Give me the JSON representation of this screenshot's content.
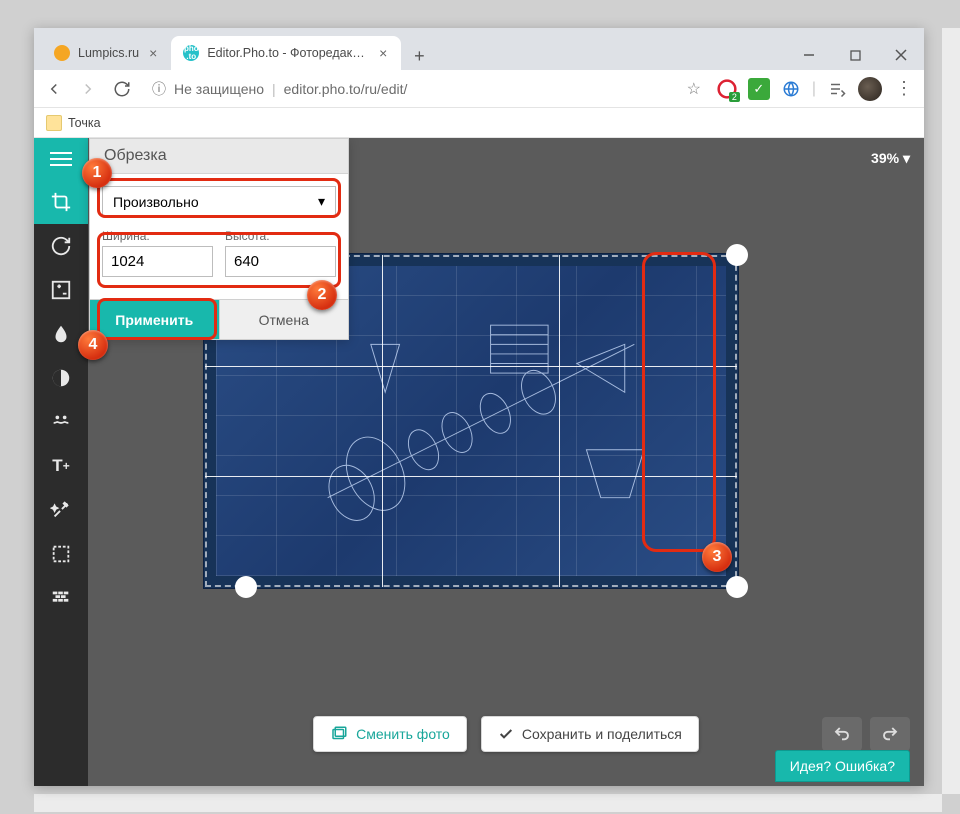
{
  "colors": {
    "accent": "#18b8ac",
    "marker": "#e22b12"
  },
  "browser": {
    "tabs": [
      {
        "title": "Lumpics.ru",
        "active": false
      },
      {
        "title": "Editor.Pho.to - Фоторедактор он",
        "active": true
      }
    ],
    "insecure_label": "Не защищено",
    "url": "editor.pho.to/ru/edit/",
    "adblock_badge": "2",
    "bookmarks": [
      {
        "label": "Точка"
      }
    ]
  },
  "sidebar": {
    "tools": [
      {
        "name": "crop",
        "active": true
      },
      {
        "name": "rotate",
        "active": false
      },
      {
        "name": "exposure",
        "active": false
      },
      {
        "name": "color",
        "active": false
      },
      {
        "name": "sharpen",
        "active": false
      },
      {
        "name": "stickers",
        "active": false
      },
      {
        "name": "text",
        "active": false
      },
      {
        "name": "effects",
        "active": false
      },
      {
        "name": "frames",
        "active": false
      },
      {
        "name": "textures",
        "active": false
      }
    ]
  },
  "zoom": {
    "label": "39%"
  },
  "crop_panel": {
    "title": "Обрезка",
    "mode_label": "Произвольно",
    "width_label": "Ширина:",
    "height_label": "Высота:",
    "width_value": "1024",
    "height_value": "640",
    "apply": "Применить",
    "cancel": "Отмена"
  },
  "bottom": {
    "change_photo": "Сменить фото",
    "save_share": "Сохранить и поделиться"
  },
  "feedback": {
    "label": "Идея? Ошибка?"
  },
  "markers": {
    "1": "1",
    "2": "2",
    "3": "3",
    "4": "4"
  }
}
